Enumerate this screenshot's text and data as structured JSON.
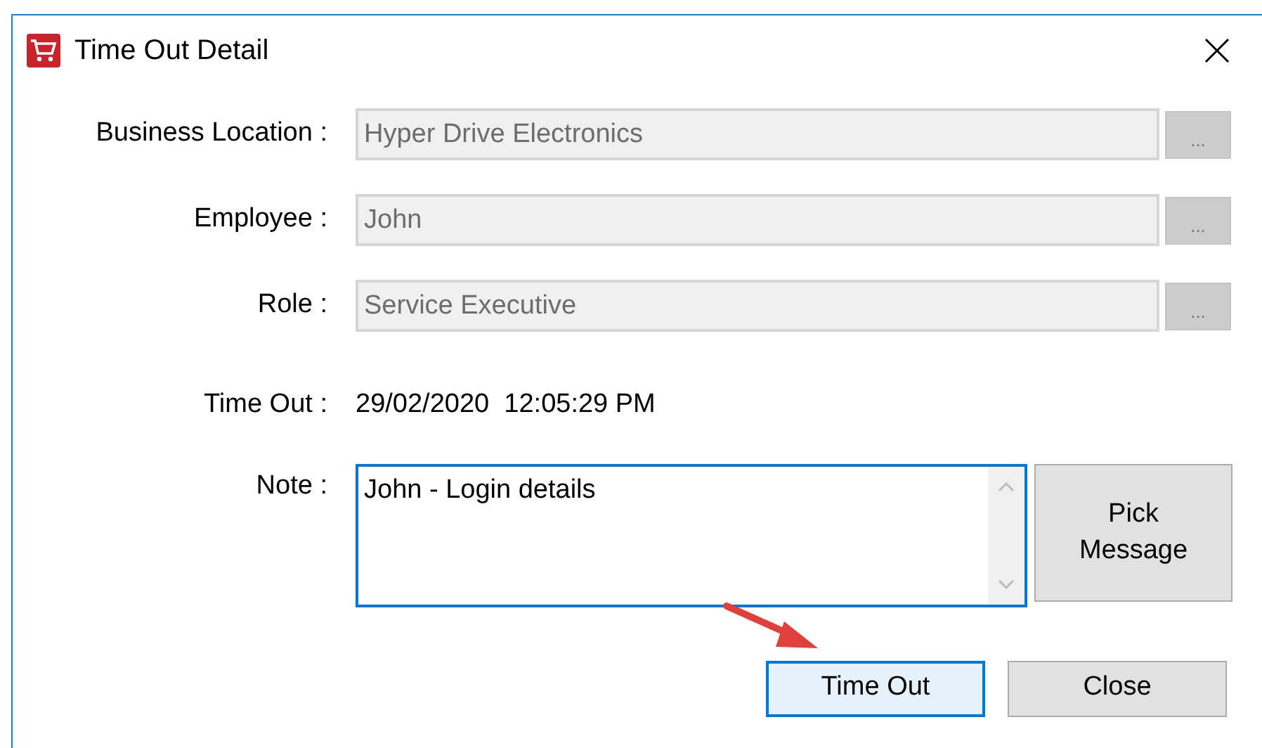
{
  "window": {
    "title": "Time Out Detail"
  },
  "fields": [
    {
      "label": "Business Location :",
      "value": "Hyper Drive Electronics",
      "disabled": true,
      "browse": "..."
    },
    {
      "label": "Employee :",
      "value": "John",
      "disabled": true,
      "browse": "..."
    },
    {
      "label": "Role :",
      "value": "Service Executive",
      "disabled": true,
      "browse": "..."
    }
  ],
  "time_out": {
    "label": "Time Out :",
    "value": "29/02/2020  12:05:29 PM"
  },
  "note": {
    "label": "Note :",
    "value": "John - Login details",
    "focused": true,
    "pick_button": "Pick Message"
  },
  "buttons": [
    {
      "label": "Time Out",
      "focused": true
    },
    {
      "label": "Close",
      "focused": false
    }
  ]
}
